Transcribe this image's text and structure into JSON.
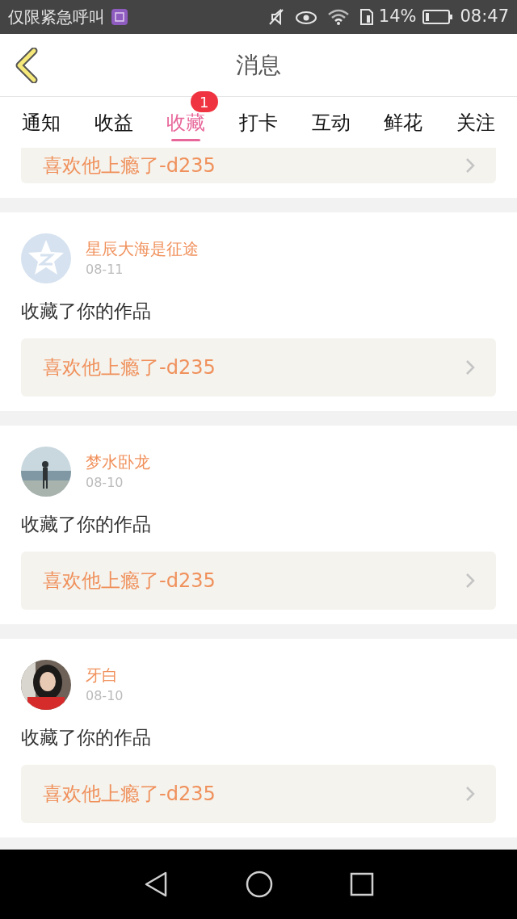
{
  "status_bar": {
    "carrier": "仅限紧急呼叫",
    "battery_text": "14%",
    "time": "08:47"
  },
  "header": {
    "title": "消息"
  },
  "tabs": [
    {
      "label": "通知",
      "selected": false
    },
    {
      "label": "收益",
      "selected": false
    },
    {
      "label": "收藏",
      "selected": true,
      "badge": "1"
    },
    {
      "label": "打卡",
      "selected": false
    },
    {
      "label": "互动",
      "selected": false
    },
    {
      "label": "鲜花",
      "selected": false
    },
    {
      "label": "关注",
      "selected": false
    }
  ],
  "partial_item": {
    "work": "喜欢他上瘾了-d235"
  },
  "items": [
    {
      "avatar": {
        "kind": "default"
      },
      "name": "星辰大海是征途",
      "date": "08-11",
      "action": "收藏了你的作品",
      "work": "喜欢他上瘾了-d235"
    },
    {
      "name": "梦水卧龙",
      "date": "08-10",
      "action": "收藏了你的作品",
      "work": "喜欢他上瘾了-d235"
    },
    {
      "name": "牙白",
      "date": "08-10",
      "action": "收藏了你的作品",
      "work": "喜欢他上瘾了-d235"
    }
  ]
}
